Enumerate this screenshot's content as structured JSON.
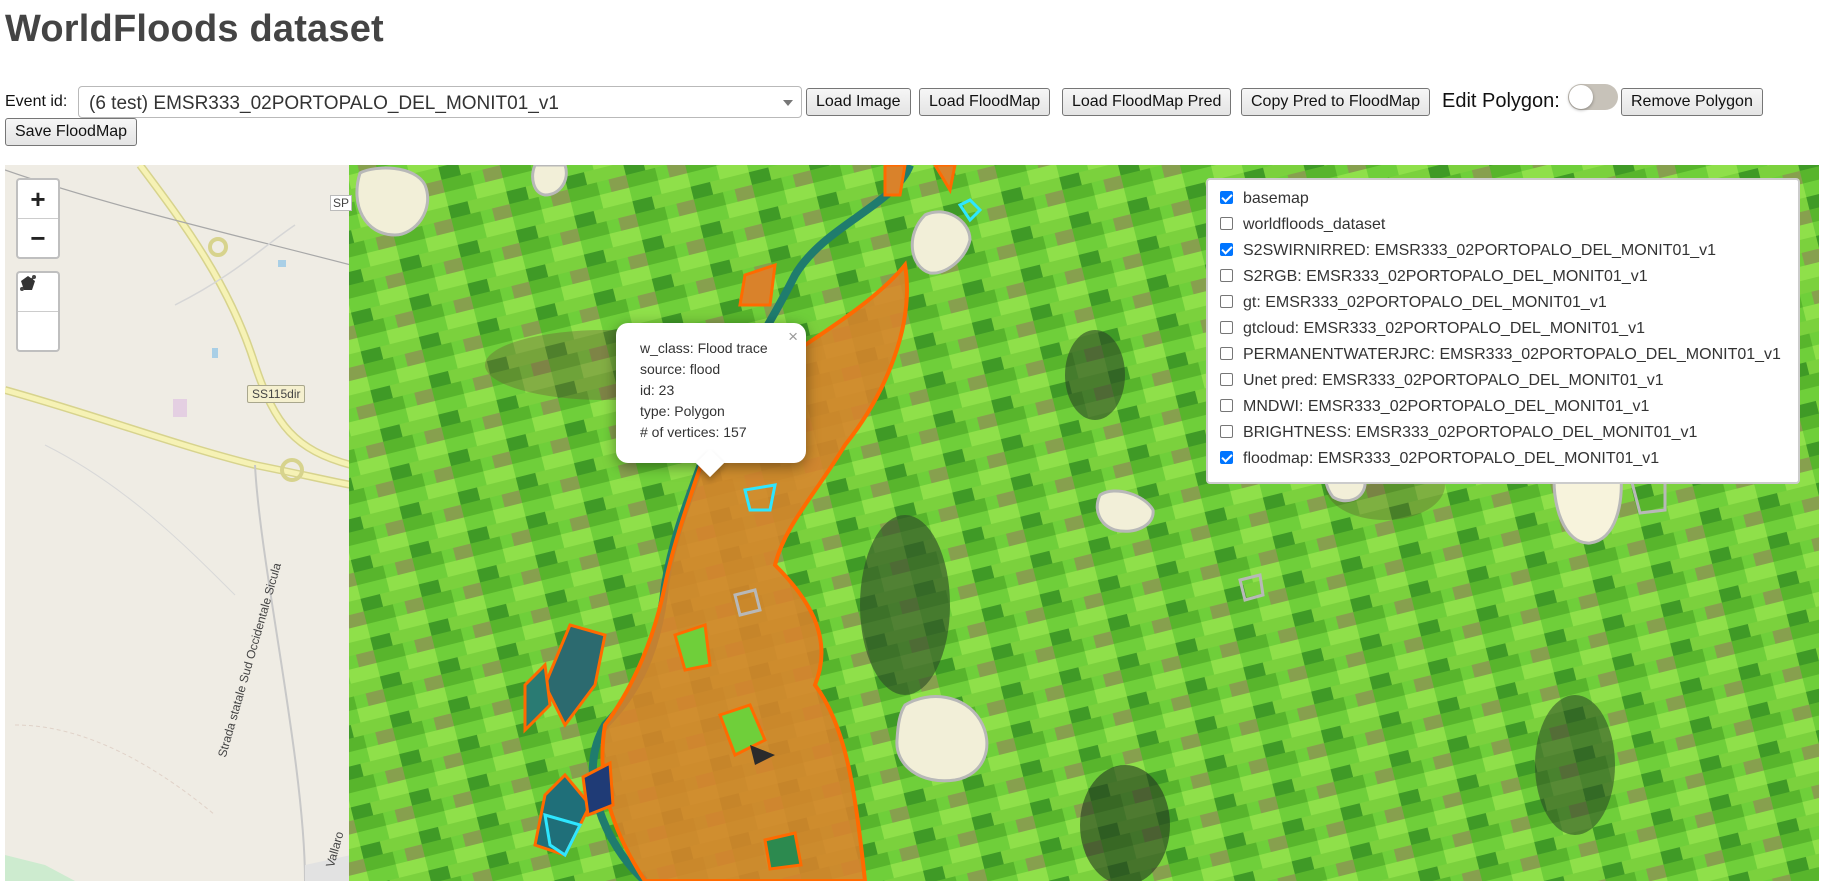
{
  "page": {
    "title": "WorldFloods dataset"
  },
  "toolbar": {
    "event_label": "Event id:",
    "event_value": "(6 test) EMSR333_02PORTOPALO_DEL_MONIT01_v1",
    "load_image": "Load Image",
    "load_floodmap": "Load FloodMap",
    "load_floodmap_pred": "Load FloodMap Pred",
    "copy_pred": "Copy Pred to FloodMap",
    "edit_polygon_label": "Edit Polygon:",
    "edit_polygon_on": false,
    "remove_polygon": "Remove Polygon",
    "save_floodmap": "Save FloodMap"
  },
  "map": {
    "zoom_in": "+",
    "zoom_out": "−",
    "tools": [
      "polyline-icon",
      "polygon-icon"
    ],
    "basemap_labels": {
      "sp": "SP",
      "ss115": "SS115dir",
      "strada": "Strada statale Sud Occidentale Sicula",
      "vallaro": "Vallaro"
    },
    "colors": {
      "flood_fill": "#d9822b",
      "flood_edge": "#ff6a00",
      "cloud_edge": "#b8b8b8",
      "water_edge": "#2ee6ff"
    },
    "popup": {
      "w_class": "w_class: Flood trace",
      "source": "source: flood",
      "id": "id: 23",
      "type": "type: Polygon",
      "vertices": "# of vertices: 157",
      "close": "×"
    },
    "layers": [
      {
        "label": "basemap",
        "checked": true
      },
      {
        "label": "worldfloods_dataset",
        "checked": false
      },
      {
        "label": "S2SWIRNIRRED: EMSR333_02PORTOPALO_DEL_MONIT01_v1",
        "checked": true
      },
      {
        "label": "S2RGB: EMSR333_02PORTOPALO_DEL_MONIT01_v1",
        "checked": false
      },
      {
        "label": "gt: EMSR333_02PORTOPALO_DEL_MONIT01_v1",
        "checked": false
      },
      {
        "label": "gtcloud: EMSR333_02PORTOPALO_DEL_MONIT01_v1",
        "checked": false
      },
      {
        "label": "PERMANENTWATERJRC: EMSR333_02PORTOPALO_DEL_MONIT01_v1",
        "checked": false
      },
      {
        "label": "Unet pred: EMSR333_02PORTOPALO_DEL_MONIT01_v1",
        "checked": false
      },
      {
        "label": "MNDWI: EMSR333_02PORTOPALO_DEL_MONIT01_v1",
        "checked": false
      },
      {
        "label": "BRIGHTNESS: EMSR333_02PORTOPALO_DEL_MONIT01_v1",
        "checked": false
      },
      {
        "label": "floodmap: EMSR333_02PORTOPALO_DEL_MONIT01_v1",
        "checked": true
      }
    ]
  }
}
